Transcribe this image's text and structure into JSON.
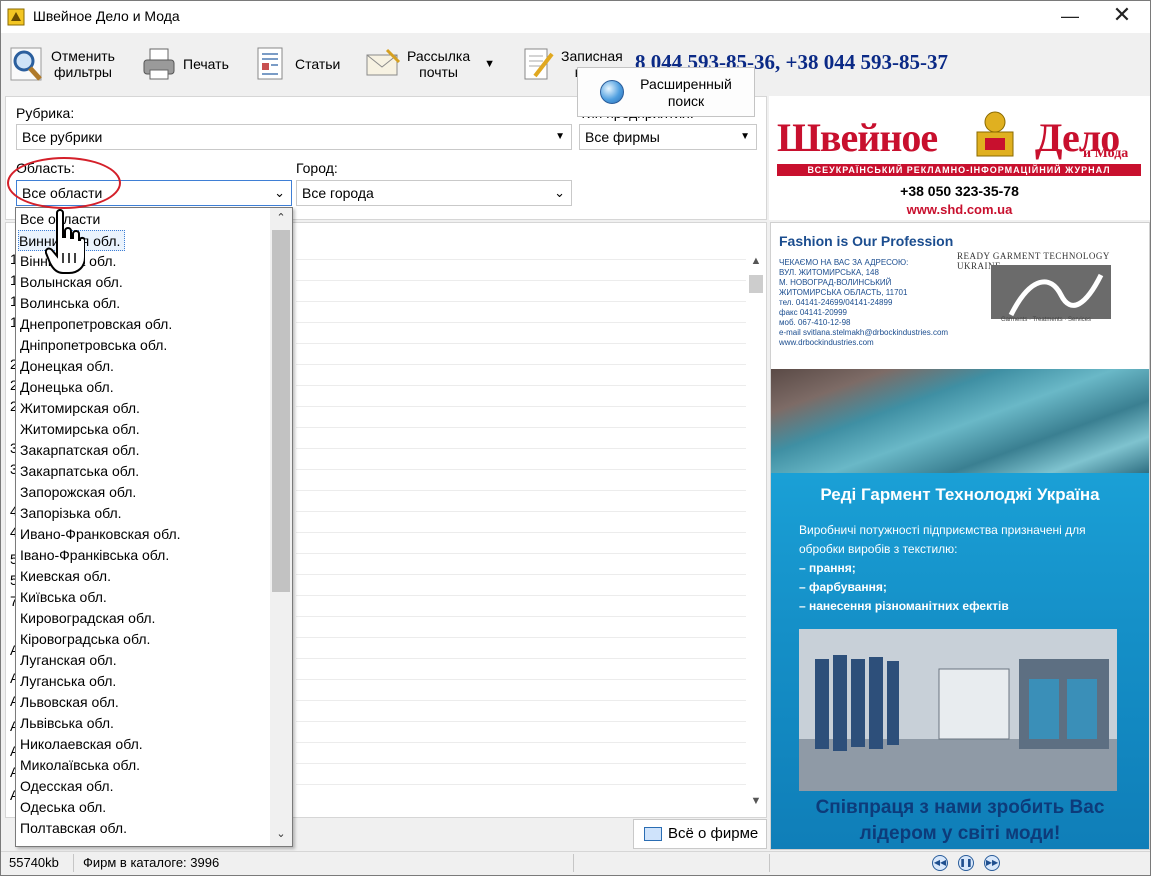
{
  "window": {
    "title": "Швейное Дело и Мода",
    "minimize_label": "—",
    "close_label": "✕"
  },
  "toolbar": {
    "reset_filters": "Отменить\nфильтры",
    "reset_line1": "Отменить",
    "reset_line2": "фильтры",
    "print": "Печать",
    "articles": "Статьи",
    "mail_line1": "Рассылка",
    "mail_line2": "почты",
    "notebook_line1": "Записная",
    "notebook_line2": "книга",
    "phones": "8 044 593-85-36, +38 044 593-85-37"
  },
  "filters": {
    "rubric_label": "Рубрика:",
    "rubric_value": "Все рубрики",
    "company_type_label": "Тип предприятия:",
    "company_type_value": "Все фирмы",
    "region_label": "Область:",
    "region_value": "Все области",
    "city_label": "Город:",
    "city_value": "Все города",
    "advanced_line1": "Расширенный",
    "advanced_line2": "поиск"
  },
  "region_dropdown": {
    "items": [
      "Все области",
      "Винницкая обл.",
      "Вінницька обл.",
      "Волынская обл.",
      "Волинська обл.",
      "Днепропетровская обл.",
      "Дніпропетровська обл.",
      "Донецкая обл.",
      "Донецька обл.",
      "Житомирская обл.",
      "Житомирська обл.",
      "Закарпатская обл.",
      "Закарпатська обл.",
      "Запорожская обл.",
      "Запорізька обл.",
      "Ивано-Франковская обл.",
      "Івано-Франківська обл.",
      "Киевская обл.",
      "Київська обл.",
      "Кировоградская обл.",
      "Кіровоградська обл.",
      "Луганская обл.",
      "Луганська обл.",
      "Львовская обл.",
      "Львівська обл.",
      "Николаевская обл.",
      "Миколаївська обл.",
      "Одесская обл.",
      "Одеська обл.",
      "Полтавская обл."
    ],
    "selected_index": 1
  },
  "list_peek": [
    "1",
    "1",
    "1",
    "1",
    "2",
    "2",
    "2",
    "3",
    "3",
    "4",
    "4",
    "5",
    "5",
    "7",
    "А",
    "А",
    "А",
    "А",
    "А",
    "А",
    "А",
    "А"
  ],
  "bottom": {
    "all_about_firm": "Всё о фирме"
  },
  "banner": {
    "title_left": "Швейное",
    "title_right": "Дело",
    "title_moda": "и Мода",
    "subtitle": "ВСЕУКРАЇНСЬКИЙ РЕКЛАМНО-ІНФОРМАЦІЙНИЙ ЖУРНАЛ",
    "phone": "+38 050 323-35-78",
    "url": "www.shd.com.ua"
  },
  "ad": {
    "fashion": "Fashion is Our Profession",
    "company_en": "READY GARMENT TECHNOLOGY UKRAINE",
    "logo_caption": "Garments · Treatments · Services",
    "contact_lines": [
      "ЧЕКАЄМО НА ВАС ЗА АДРЕСОЮ:",
      "ВУЛ. ЖИТОМИРСЬКА, 148",
      "М. НОВОГРАД-ВОЛИНСЬКИЙ",
      "ЖИТОМИРСЬКА ОБЛАСТЬ, 11701",
      "тел.   04141-24699/04141-24899",
      "факс  04141-20999",
      "моб.  067-410-12-98",
      "e-mail  svitlana.stelmakh@drbockindustries.com",
      "www.drbockindustries.com"
    ],
    "heading": "Реді Гармент Технолоджі Україна",
    "text_intro_1": "Виробничі потужності підприємства призначені для",
    "text_intro_2": "обробки виробів з текстилю:",
    "bullets": [
      "– прання;",
      "– фарбування;",
      "– нанесення різноманітних ефектів"
    ],
    "footer_1": "Співпраця з нами зробить Вас",
    "footer_2": "лідером у світі моди!"
  },
  "status": {
    "size": "55740kb",
    "firms_count": "Фирм в каталоге: 3996"
  },
  "colors": {
    "brand_red": "#c8102e",
    "phone_blue": "#0b2a86",
    "ad_blue": "#1590c8",
    "highlight_red": "#d4202a"
  }
}
